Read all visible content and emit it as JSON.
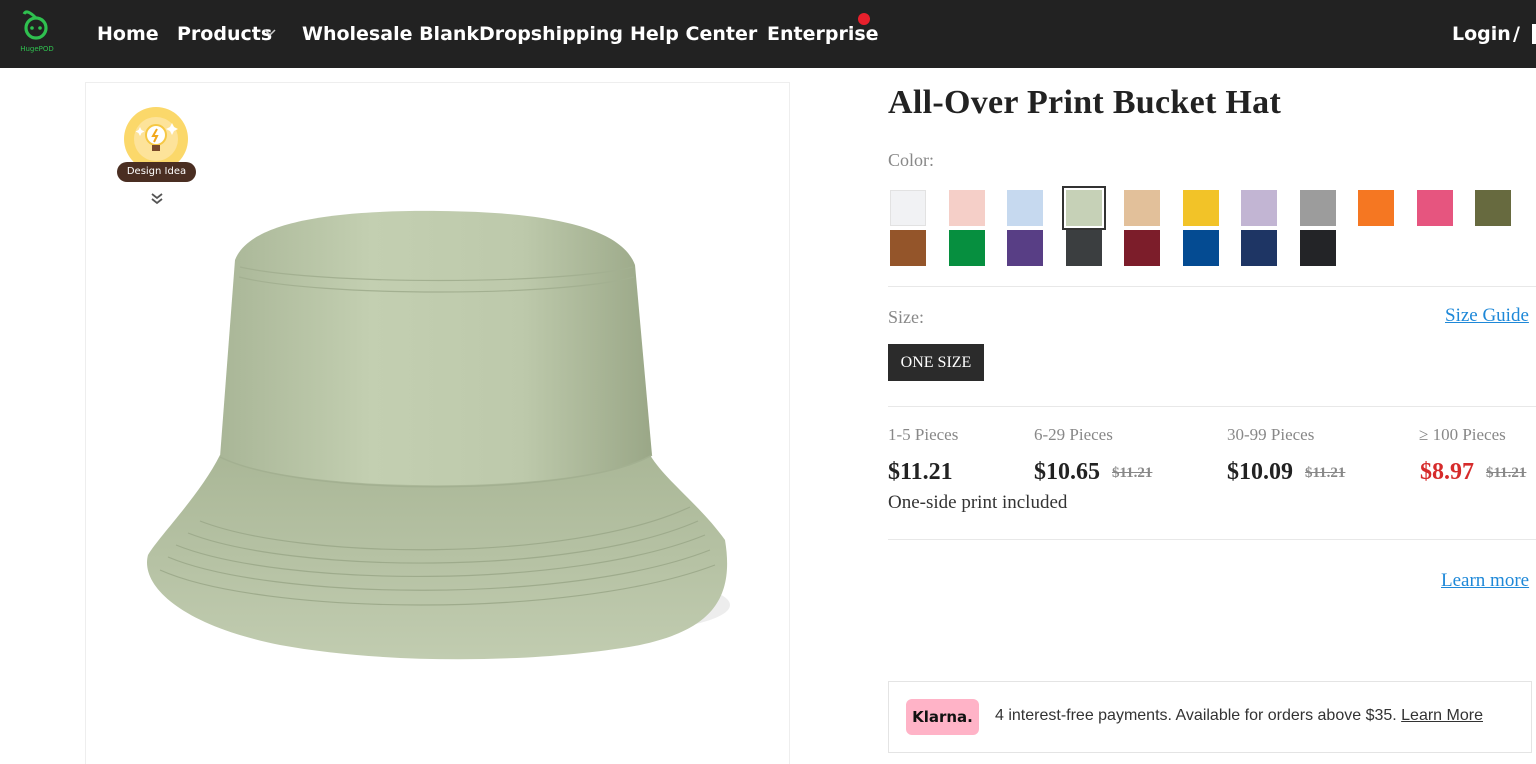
{
  "nav": {
    "logo_text": "HugePOD",
    "items": [
      {
        "label": "Home"
      },
      {
        "label": "Products"
      },
      {
        "label": "Wholesale Blank"
      },
      {
        "label": "Dropshipping"
      },
      {
        "label": "Help Center"
      },
      {
        "label": "Enterprise"
      }
    ],
    "login": "Login",
    "login_sep": "/"
  },
  "design_idea": {
    "label": "Design Idea"
  },
  "product": {
    "title": "All-Over Print Bucket Hat",
    "color_label": "Color:",
    "colors": [
      "#f1f2f4",
      "#f5cfc8",
      "#c6d9ef",
      "#c6d1b7",
      "#e2c09a",
      "#f2c328",
      "#c2b5d3",
      "#9c9c9c",
      "#f57722",
      "#e6557f",
      "#676a3f",
      "#94552a",
      "#068f3f",
      "#583e85",
      "#3b3e40",
      "#7c1d2a",
      "#044b92",
      "#1e3564",
      "#232427"
    ],
    "selected_color": "#c6d1b7",
    "size_label": "Size:",
    "size_guide": "Size Guide",
    "size_option": "ONE SIZE",
    "tiers": [
      {
        "label": "1-5 Pieces",
        "price": "$11.21",
        "original": ""
      },
      {
        "label": "6-29 Pieces",
        "price": "$10.65",
        "original": "$11.21"
      },
      {
        "label": "30-99 Pieces",
        "price": "$10.09",
        "original": "$11.21"
      },
      {
        "label": "≥ 100 Pieces",
        "price": "$8.97",
        "original": "$11.21"
      }
    ],
    "print_note": "One-side print included",
    "learn_more": "Learn more"
  },
  "klarna": {
    "logo": "Klarna.",
    "text": "4 interest-free payments. Available for orders above $35. ",
    "link": "Learn More"
  },
  "colors": {
    "nav_bg": "#222222",
    "link": "#1e88d8",
    "sale": "#d62b2b",
    "brand_green": "#2fc04f"
  }
}
